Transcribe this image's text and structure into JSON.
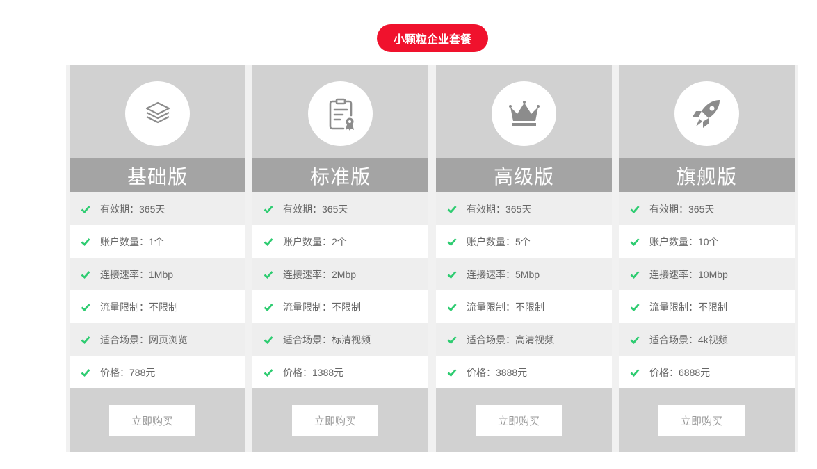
{
  "colors": {
    "accent": "#f0122d",
    "check": "#2ecc71",
    "icon": "#8c8c8c"
  },
  "header": {
    "badge_label": "小颗粒企业套餐"
  },
  "plans": [
    {
      "name": "基础版",
      "icon": "layers-icon",
      "features": [
        "有效期：365天",
        "账户数量：1个",
        "连接速率：1Mbp",
        "流量限制：不限制",
        "适合场景：网页浏览",
        "价格：788元"
      ],
      "button_label": "立即购买"
    },
    {
      "name": "标准版",
      "icon": "certificate-icon",
      "features": [
        "有效期：365天",
        "账户数量：2个",
        "连接速率：2Mbp",
        "流量限制：不限制",
        "适合场景：标清视频",
        "价格：1388元"
      ],
      "button_label": "立即购买"
    },
    {
      "name": "高级版",
      "icon": "crown-icon",
      "features": [
        "有效期：365天",
        "账户数量：5个",
        "连接速率：5Mbp",
        "流量限制：不限制",
        "适合场景：高清视频",
        "价格：3888元"
      ],
      "button_label": "立即购买"
    },
    {
      "name": "旗舰版",
      "icon": "rocket-icon",
      "features": [
        "有效期：365天",
        "账户数量：10个",
        "连接速率：10Mbp",
        "流量限制：不限制",
        "适合场景：4k视频",
        "价格：6888元"
      ],
      "button_label": "立即购买"
    }
  ]
}
